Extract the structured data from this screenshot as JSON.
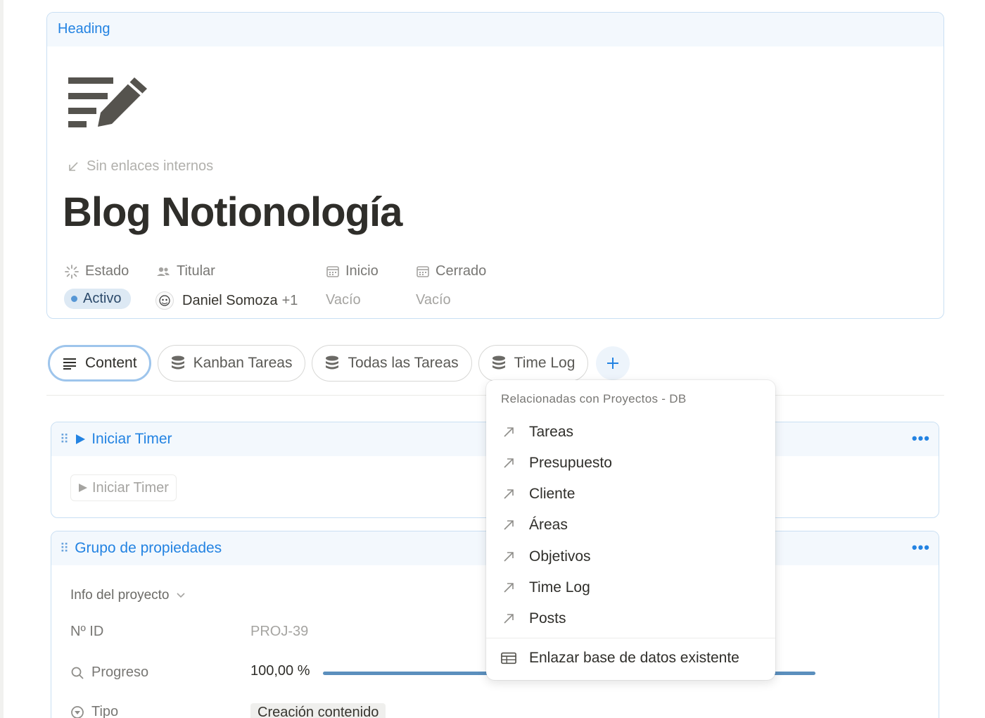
{
  "heading": {
    "label": "Heading",
    "page_icon": "notes-pencil-icon",
    "backlinks": "Sin enlaces internos",
    "title": "Blog Notionología"
  },
  "properties": [
    {
      "label": "Estado",
      "icon": "status-icon",
      "value": "Activo"
    },
    {
      "label": "Titular",
      "icon": "people-icon",
      "value": "Daniel Somoza",
      "extra": "+1"
    },
    {
      "label": "Inicio",
      "icon": "calendar-icon",
      "value": "Vacío"
    },
    {
      "label": "Cerrado",
      "icon": "calendar-icon",
      "value": "Vacío"
    }
  ],
  "tabs": [
    {
      "label": "Content",
      "icon": "text-lines-icon",
      "active": true
    },
    {
      "label": "Kanban Tareas",
      "icon": "database-icon"
    },
    {
      "label": "Todas las Tareas",
      "icon": "database-icon"
    },
    {
      "label": "Time Log",
      "icon": "database-icon"
    }
  ],
  "tab_add": "+",
  "timer_section": {
    "title": "Iniciar Timer",
    "button_label": "Iniciar Timer",
    "more": "•••"
  },
  "properties_section": {
    "title": "Grupo de propiedades",
    "group_label": "Info del proyecto",
    "more": "•••",
    "rows": [
      {
        "label": "Nº ID",
        "value": "PROJ-39"
      },
      {
        "label": "Progreso",
        "value": "100,00 %",
        "progress": 1.0
      },
      {
        "label": "Tipo",
        "value": "Creación contenido"
      }
    ]
  },
  "menu": {
    "header": "Relacionadas con Proyectos - DB",
    "items": [
      "Tareas",
      "Presupuesto",
      "Cliente",
      "Áreas",
      "Objetivos",
      "Time Log",
      "Posts"
    ],
    "link_existing": "Enlazar base de datos existente"
  },
  "colors": {
    "accent": "#2383e2",
    "status_pill": "#dde9f4",
    "status_dot": "#5797d5",
    "progress": "#5b8fbd"
  }
}
